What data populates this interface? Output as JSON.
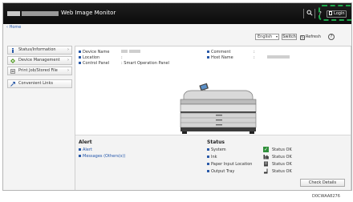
{
  "header": {
    "app_title": "Web Image Monitor",
    "search_icon": "search-icon",
    "help_glyph": "?",
    "login_label": "Login"
  },
  "breadcrumb": "Home",
  "controls": {
    "language": "English",
    "switch_label": "Switch",
    "refresh_label": "Refresh",
    "help_glyph": "?"
  },
  "sidebar": {
    "items": [
      {
        "label": "Status/Information",
        "icon": "info-icon"
      },
      {
        "label": "Device Management",
        "icon": "device-management-icon"
      },
      {
        "label": "Print Job/Stored File",
        "icon": "print-job-icon"
      },
      {
        "label": "Convenient Links",
        "icon": "link-icon"
      }
    ]
  },
  "device_info": {
    "device_name_label": "Device Name",
    "location_label": "Location",
    "location_value": ":",
    "control_panel_label": "Control Panel",
    "control_panel_value": ": Smart Operation Panel",
    "comment_label": "Comment",
    "comment_value": ":",
    "host_name_label": "Host Name",
    "host_name_value": ":"
  },
  "alert": {
    "title": "Alert",
    "links": [
      "Alert",
      "Messages (Others(s))"
    ]
  },
  "status": {
    "title": "Status",
    "rows": [
      {
        "label": "System",
        "value": "Status OK",
        "icon": "system-status-icon"
      },
      {
        "label": "Ink",
        "value": "Status OK",
        "icon": "ink-status-icon"
      },
      {
        "label": "Paper Input Location",
        "value": "Status OK",
        "icon": "paper-input-icon"
      },
      {
        "label": "Output Tray",
        "value": "Status OK",
        "icon": "output-tray-icon"
      }
    ],
    "check_details_label": "Check Details"
  },
  "caption": "D0CWAA8276",
  "colors": {
    "header_bg": "#111111",
    "highlight": "#1ea84b",
    "link": "#2255aa"
  }
}
